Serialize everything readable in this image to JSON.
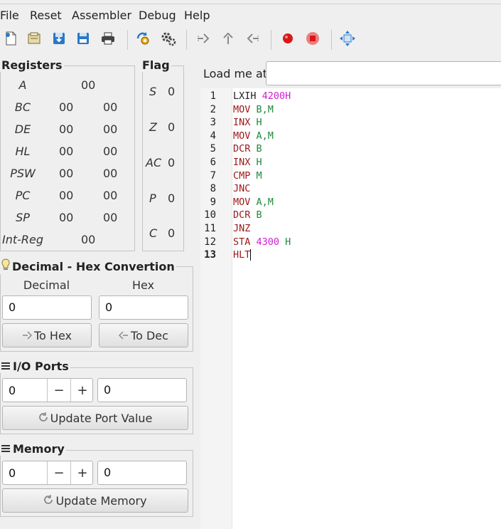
{
  "menu": [
    "File",
    "Reset",
    "Assembler",
    "Debug",
    "Help"
  ],
  "toolbar": {
    "icons": [
      "new-file-icon",
      "open-file-icon",
      "save-icon",
      "save-as-icon",
      "print-icon",
      "assemble-icon",
      "settings-gear-icon",
      "step-into-icon",
      "step-out-icon",
      "step-back-icon",
      "breakpoint-icon",
      "stop-icon",
      "fit-window-icon"
    ],
    "colors": {
      "blue": "#2a78c8",
      "red": "#d81818",
      "red_light": "#e98080"
    }
  },
  "load": {
    "label": "Load me at",
    "value": ""
  },
  "registers": {
    "title": "Registers",
    "rows": [
      {
        "name": "A",
        "v1": "00",
        "v2": ""
      },
      {
        "name": "BC",
        "v1": "00",
        "v2": "00"
      },
      {
        "name": "DE",
        "v1": "00",
        "v2": "00"
      },
      {
        "name": "HL",
        "v1": "00",
        "v2": "00"
      },
      {
        "name": "PSW",
        "v1": "00",
        "v2": "00"
      },
      {
        "name": "PC",
        "v1": "00",
        "v2": "00"
      },
      {
        "name": "SP",
        "v1": "00",
        "v2": "00"
      },
      {
        "name": "Int-Reg",
        "v1": "00",
        "v2": ""
      }
    ]
  },
  "flags": {
    "title": "Flag",
    "items": [
      {
        "name": "S",
        "value": "0"
      },
      {
        "name": "Z",
        "value": "0"
      },
      {
        "name": "AC",
        "value": "0"
      },
      {
        "name": "P",
        "value": "0"
      },
      {
        "name": "C",
        "value": "0"
      }
    ]
  },
  "conversion": {
    "title": "Decimal - Hex Convertion",
    "decimal_label": "Decimal",
    "hex_label": "Hex",
    "decimal_value": "0",
    "hex_value": "0",
    "to_hex": "To Hex",
    "to_dec": "To Dec"
  },
  "io": {
    "title": "I/O Ports",
    "port": "0",
    "minus": "−",
    "plus": "+",
    "value": "0",
    "update": "Update Port Value"
  },
  "memory": {
    "title": "Memory",
    "address": "0",
    "minus": "−",
    "plus": "+",
    "value": "0",
    "update": "Update Memory"
  },
  "code": {
    "colors": {
      "mnemonic": "#a01818",
      "operand": "#1f8a3a",
      "number": "#d020d0",
      "plain": "#222222"
    },
    "lines": [
      [
        {
          "t": "LXIH ",
          "c": "plain"
        },
        {
          "t": "4200H",
          "c": "number"
        }
      ],
      [
        {
          "t": "MOV ",
          "c": "mnemonic"
        },
        {
          "t": "B,M",
          "c": "operand"
        }
      ],
      [
        {
          "t": "INX ",
          "c": "mnemonic"
        },
        {
          "t": "H",
          "c": "operand"
        }
      ],
      [
        {
          "t": "MOV ",
          "c": "mnemonic"
        },
        {
          "t": "A,M",
          "c": "operand"
        }
      ],
      [
        {
          "t": "DCR ",
          "c": "mnemonic"
        },
        {
          "t": "B",
          "c": "operand"
        }
      ],
      [
        {
          "t": "INX ",
          "c": "mnemonic"
        },
        {
          "t": "H",
          "c": "operand"
        }
      ],
      [
        {
          "t": "CMP ",
          "c": "mnemonic"
        },
        {
          "t": "M",
          "c": "operand"
        }
      ],
      [
        {
          "t": "JNC",
          "c": "mnemonic"
        }
      ],
      [
        {
          "t": "MOV ",
          "c": "mnemonic"
        },
        {
          "t": "A,M",
          "c": "operand"
        }
      ],
      [
        {
          "t": "DCR ",
          "c": "mnemonic"
        },
        {
          "t": "B",
          "c": "operand"
        }
      ],
      [
        {
          "t": "JNZ",
          "c": "mnemonic"
        }
      ],
      [
        {
          "t": "STA ",
          "c": "mnemonic"
        },
        {
          "t": "4300 ",
          "c": "number"
        },
        {
          "t": "H",
          "c": "operand"
        }
      ],
      [
        {
          "t": "HLT",
          "c": "mnemonic"
        }
      ]
    ]
  }
}
